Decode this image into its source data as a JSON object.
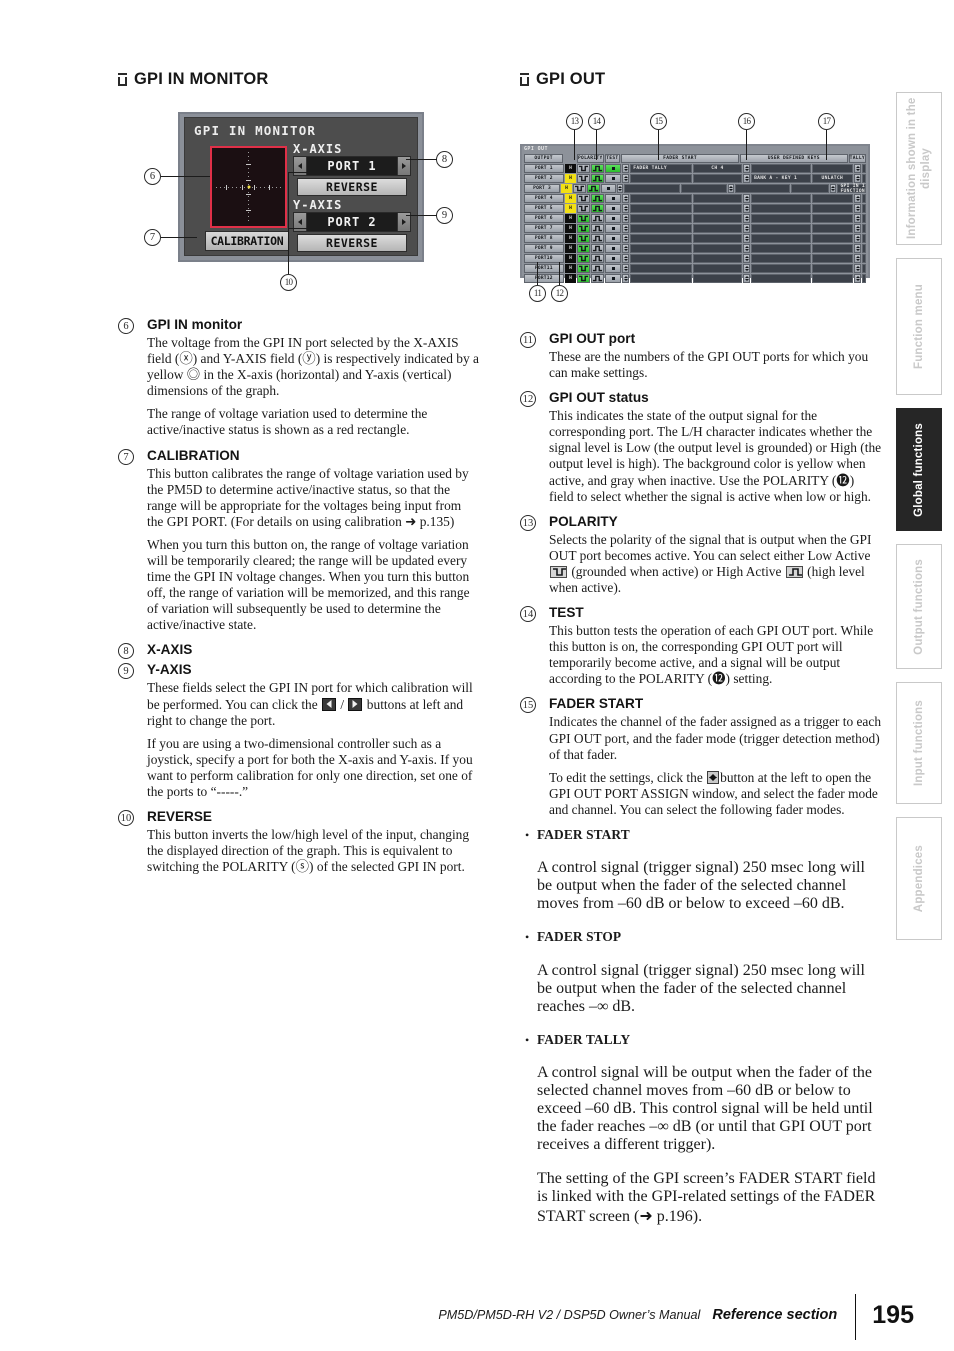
{
  "left_column": {
    "heading": "GPI IN MONITOR",
    "figure": {
      "lcd_title": "GPI IN MONITOR",
      "x_axis_label": "X-AXIS",
      "y_axis_label": "Y-AXIS",
      "x_port_value": "PORT 1",
      "y_port_value": "PORT 2",
      "x_reverse_label": "REVERSE",
      "y_reverse_label": "REVERSE",
      "calibration_label": "CALIBRATION",
      "callouts": [
        "6",
        "7",
        "8",
        "9",
        "10"
      ]
    },
    "items": [
      {
        "num": "6",
        "title": "GPI IN monitor",
        "paragraphs": [
          "The voltage from the GPI IN port selected by the X-AXIS field (ⓧ) and Y-AXIS field (ⓨ) is respectively indicated by a yellow ◎ in the X-axis (horizontal) and Y-axis (vertical) dimensions of the graph.",
          "The range of voltage variation used to determine the active/inactive status is shown as a red rectangle."
        ]
      },
      {
        "num": "7",
        "title": "CALIBRATION",
        "paragraphs": [
          "This button calibrates the range of voltage variation used by the PM5D to determine active/inactive status, so that the range will be appropriate for the voltages being input from the GPI PORT. (For details on using calibration ➜ p.135)",
          "When you turn this button on, the range of voltage variation will be temporarily cleared; the range will be updated every time the GPI IN voltage changes. When you turn this button off, the range of variation will be memorized, and this range of variation will subsequently be used to determine the active/inactive state."
        ]
      },
      {
        "num": "8",
        "title": "X-AXIS",
        "paragraphs": []
      },
      {
        "num": "9",
        "title": "Y-AXIS",
        "paragraphs": [
          "These fields select the GPI IN port for which calibration will be performed. You can click the ◀ / ▶ buttons at left and right to change the port.",
          "If you are using a two-dimensional controller such as a joystick, specify a port for both the X-axis and Y-axis. If you want to perform calibration for only one direction, set one of the ports to “-----.”"
        ]
      },
      {
        "num": "10",
        "title": "REVERSE",
        "paragraphs": [
          "This button inverts the low/high level of the input, changing the displayed direction of the graph. This is equivalent to switching the POLARITY (ⓢ) of the selected GPI IN port."
        ]
      }
    ]
  },
  "right_column": {
    "heading": "GPI OUT",
    "items": [
      {
        "num": "11",
        "title": "GPI OUT port",
        "paragraphs": [
          "These are the numbers of the GPI OUT ports for which you can make settings."
        ]
      },
      {
        "num": "12",
        "title": "GPI OUT status",
        "paragraphs": [
          "This indicates the state of the output signal for the corresponding port. The L/H character indicates whether the signal level is Low (the output level is grounded) or High (the output level is high). The background color is yellow when active, and gray when inactive. Use the POLARITY (⓬) field to select whether the signal is active when low or high."
        ]
      },
      {
        "num": "13",
        "title": "POLARITY",
        "paragraphs": [
          "Selects the polarity of the signal that is output when the GPI OUT port becomes active. You can select either Low Active [icon] (grounded when active) or High Active [icon] (high level when active)."
        ]
      },
      {
        "num": "14",
        "title": "TEST",
        "paragraphs": [
          "This button tests the operation of each GPI OUT port. While this button is on, the corresponding GPI OUT port will temporarily become active, and a signal will be output according to the POLARITY (⓬) setting."
        ]
      },
      {
        "num": "15",
        "title": "FADER START",
        "paragraphs": [
          "Indicates the channel of the fader assigned as a trigger to each GPI OUT port, and the fader mode (trigger detection method) of that fader.",
          "To edit the settings, click the [spin] button at the left to open the GPI OUT PORT ASSIGN window, and select the fader mode and channel. You can select the following fader modes."
        ]
      }
    ],
    "bullets": [
      {
        "title": "FADER START",
        "text": "A control signal (trigger signal) 250 msec long will be output when the fader of the selected channel moves from –60 dB or below to exceed –60 dB."
      },
      {
        "title": "FADER STOP",
        "text": "A control signal (trigger signal) 250 msec long will be output when the fader of the selected channel reaches –∞ dB."
      },
      {
        "title": "FADER TALLY",
        "text": "A control signal will be output when the fader of the selected channel moves from –60 dB or below to exceed –60 dB. This control signal will be held until the fader reaches –∞ dB (or until that GPI OUT port receives a different trigger)."
      }
    ],
    "closing_paragraph": "The setting of the GPI screen’s FADER START field is linked with the GPI-related settings of the FADER START screen (➜ p.196)."
  },
  "gpi_out_screen": {
    "window_title": "GPI OUT",
    "callouts": [
      "11",
      "12",
      "13",
      "14",
      "15",
      "16",
      "17"
    ],
    "columns": [
      "OUTPUT",
      "POLARITY",
      "TEST",
      "FADER START",
      "USER DEFINED KEYS",
      "TALLY"
    ],
    "rows": [
      {
        "port": "PORT 1",
        "status": "H",
        "status_active": false,
        "polarity": "high",
        "test_on": true,
        "fader_mode": "FADER TALLY",
        "fader_ch": "CH 4",
        "udk_bank": "",
        "udk_mode": "",
        "tally": ""
      },
      {
        "port": "PORT 2",
        "status": "H",
        "status_active": true,
        "polarity": "high",
        "test_on": false,
        "fader_mode": "",
        "fader_ch": "",
        "udk_bank": "BANK A - KEY 1",
        "udk_mode": "UNLATCH",
        "tally": ""
      },
      {
        "port": "PORT 3",
        "status": "H",
        "status_active": true,
        "polarity": "high",
        "test_on": false,
        "fader_mode": "",
        "fader_ch": "",
        "udk_bank": "",
        "udk_mode": "",
        "tally": "GPI IN 1 FUNCTION"
      },
      {
        "port": "PORT 4",
        "status": "H",
        "status_active": true,
        "polarity": "high",
        "test_on": false,
        "fader_mode": "",
        "fader_ch": "",
        "udk_bank": "",
        "udk_mode": "",
        "tally": ""
      },
      {
        "port": "PORT 5",
        "status": "H",
        "status_active": true,
        "polarity": "high",
        "test_on": false,
        "fader_mode": "",
        "fader_ch": "",
        "udk_bank": "",
        "udk_mode": "",
        "tally": ""
      },
      {
        "port": "PORT 6",
        "status": "H",
        "status_active": false,
        "polarity": "low",
        "test_on": false,
        "fader_mode": "",
        "fader_ch": "",
        "udk_bank": "",
        "udk_mode": "",
        "tally": ""
      },
      {
        "port": "PORT 7",
        "status": "H",
        "status_active": false,
        "polarity": "low",
        "test_on": false,
        "fader_mode": "",
        "fader_ch": "",
        "udk_bank": "",
        "udk_mode": "",
        "tally": ""
      },
      {
        "port": "PORT 8",
        "status": "H",
        "status_active": false,
        "polarity": "low",
        "test_on": false,
        "fader_mode": "",
        "fader_ch": "",
        "udk_bank": "",
        "udk_mode": "",
        "tally": ""
      },
      {
        "port": "PORT 9",
        "status": "H",
        "status_active": false,
        "polarity": "low",
        "test_on": false,
        "fader_mode": "",
        "fader_ch": "",
        "udk_bank": "",
        "udk_mode": "",
        "tally": ""
      },
      {
        "port": "PORT10",
        "status": "H",
        "status_active": false,
        "polarity": "low",
        "test_on": false,
        "fader_mode": "",
        "fader_ch": "",
        "udk_bank": "",
        "udk_mode": "",
        "tally": ""
      },
      {
        "port": "PORT11",
        "status": "H",
        "status_active": false,
        "polarity": "low",
        "test_on": false,
        "fader_mode": "",
        "fader_ch": "",
        "udk_bank": "",
        "udk_mode": "",
        "tally": ""
      },
      {
        "port": "PORT12",
        "status": "H",
        "status_active": false,
        "polarity": "low",
        "test_on": false,
        "fader_mode": "",
        "fader_ch": "",
        "udk_bank": "",
        "udk_mode": "",
        "tally": ""
      }
    ]
  },
  "side_tabs": [
    {
      "label": "Information shown in the display",
      "active": false
    },
    {
      "label": "Function menu",
      "active": false
    },
    {
      "label": "Global functions",
      "active": true
    },
    {
      "label": "Output functions",
      "active": false
    },
    {
      "label": "Input functions",
      "active": false
    },
    {
      "label": "Appendices",
      "active": false
    }
  ],
  "footer": {
    "manual": "PM5D/PM5D-RH V2 / DSP5D Owner’s Manual",
    "section": "Reference section",
    "page": "195"
  },
  "colors": {
    "accent_red": "#e03048",
    "active_yellow": "#f2e015",
    "selected_green": "#2cbf2c",
    "tab_active_bg": "#262626"
  }
}
